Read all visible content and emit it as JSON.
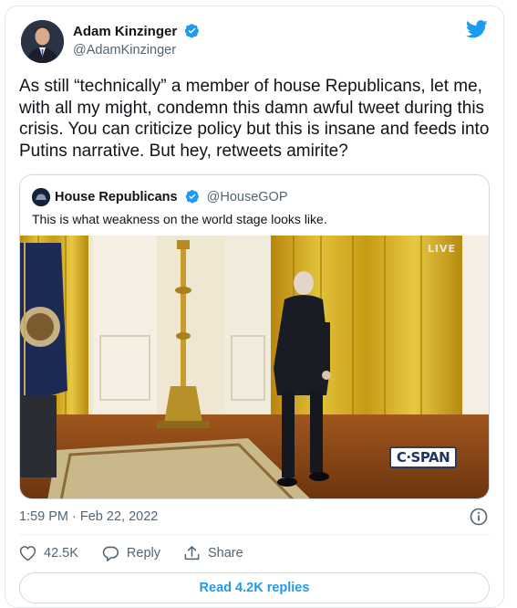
{
  "author": {
    "name": "Adam Kinzinger",
    "handle": "@AdamKinzinger",
    "verified": true
  },
  "tweet": {
    "text": "As still “technically” a member of house Republicans, let me, with all my might, condemn this damn awful tweet during this crisis.  You can criticize policy but this is insane and feeds into Putins narrative.  But hey, retweets amirite?",
    "timestamp": "1:59 PM · Feb 22, 2022"
  },
  "quoted_tweet": {
    "name": "House Republicans",
    "handle": "@HouseGOP",
    "verified": true,
    "text": "This is what weakness on the world stage looks like.",
    "media": {
      "live_badge": "LIVE",
      "watermark": "C·SPAN"
    }
  },
  "actions": {
    "likes": "42.5K",
    "reply_label": "Reply",
    "share_label": "Share"
  },
  "read_replies_label": "Read 4.2K replies",
  "colors": {
    "twitter_blue": "#1d9bf0",
    "text": "#0f1419",
    "secondary": "#536471",
    "border": "#cfd9de"
  },
  "icons": [
    "verified-badge-icon",
    "twitter-bird-icon",
    "heart-icon",
    "reply-icon",
    "share-icon",
    "info-icon"
  ]
}
